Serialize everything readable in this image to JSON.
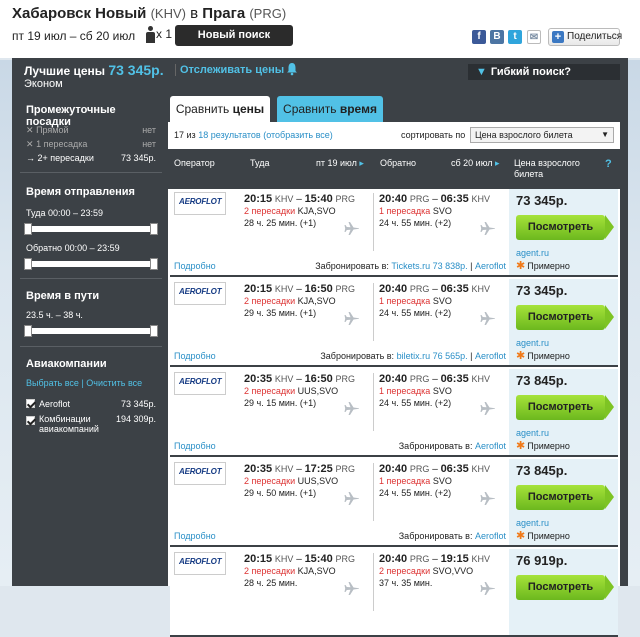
{
  "header": {
    "from_city": "Хабаровск Новый",
    "from_code": "(KHV)",
    "in_word": "в",
    "to_city": "Прага",
    "to_code": "(PRG)",
    "dates": "пт 19 июл – сб 20 июл",
    "passengers": "x 1",
    "new_search": "Новый поиск",
    "share_label": "Поделиться",
    "social_icons": [
      "facebook-icon",
      "vk-icon",
      "twitter-icon",
      "mail-icon"
    ]
  },
  "summary": {
    "best_label": "Лучшие цены",
    "best_price": "73 345р.",
    "track_label": "Отслеживать цены",
    "class": "Эконом",
    "flex_label": "Гибкий поиск?"
  },
  "sidebar": {
    "stops_title": "Промежуточные посадки",
    "stops": [
      {
        "label": "Прямой",
        "value": "нет",
        "mark": "✕"
      },
      {
        "label": "1 пересадка",
        "value": "нет",
        "mark": "✕"
      },
      {
        "label": "2+ пересадки",
        "value": "73 345р.",
        "mark": "→"
      }
    ],
    "departure_title": "Время отправления",
    "there_range": "Туда 00:00 – 23:59",
    "back_range": "Обратно 00:00 – 23:59",
    "travel_title": "Время в пути",
    "travel_range": "23.5 ч. – 38 ч.",
    "airlines_title": "Авиакомпании",
    "select_all": "Выбрать все",
    "clear_all": "Очистить все",
    "airlines": [
      {
        "name": "Aeroflot",
        "price": "73 345р."
      },
      {
        "name": "Комбинации авиакомпаний",
        "price": "194 309р."
      }
    ]
  },
  "tabs": {
    "prices_a": "Сравнить ",
    "prices_b": "цены",
    "time_a": "Сравнить ",
    "time_b": "время"
  },
  "results": {
    "shown": "17 из",
    "total": "18 результатов (отобразить все)",
    "sort_label": "сортировать по",
    "sort_value": "Цена взрослого билета"
  },
  "table_header": {
    "operator": "Оператор",
    "there": "Туда",
    "there_date": "пт 19 июл",
    "back": "Обратно",
    "back_date": "сб 20 июл",
    "price": "Цена взрослого билета",
    "help": "?"
  },
  "rows": [
    {
      "airline": "AEROFLOT",
      "out_dep": "20:15",
      "out_dep_code": "KHV",
      "out_arr": "15:40",
      "out_arr_code": "PRG",
      "out_stops": "2 пересадки",
      "out_via": "KJA,SVO",
      "out_dur": "28 ч. 25 мин. (+1)",
      "ret_dep": "20:40",
      "ret_dep_code": "PRG",
      "ret_arr": "06:35",
      "ret_arr_code": "KHV",
      "ret_stops": "1 пересадка",
      "ret_via": "SVO",
      "ret_dur": "24 ч. 55 мин. (+2)",
      "price": "73 345р.",
      "button": "Посмотреть",
      "agent": "agent.ru",
      "approx": "Примерно",
      "more": "Подробно",
      "book_label": "Забронировать в:",
      "book_links": "Tickets.ru 73 838р.",
      "book_last": "Aeroflot"
    },
    {
      "airline": "AEROFLOT",
      "out_dep": "20:15",
      "out_dep_code": "KHV",
      "out_arr": "16:50",
      "out_arr_code": "PRG",
      "out_stops": "2 пересадки",
      "out_via": "KJA,SVO",
      "out_dur": "29 ч. 35 мин. (+1)",
      "ret_dep": "20:40",
      "ret_dep_code": "PRG",
      "ret_arr": "06:35",
      "ret_arr_code": "KHV",
      "ret_stops": "1 пересадка",
      "ret_via": "SVO",
      "ret_dur": "24 ч. 55 мин. (+2)",
      "price": "73 345р.",
      "button": "Посмотреть",
      "agent": "agent.ru",
      "approx": "Примерно",
      "more": "Подробно",
      "book_label": "Забронировать в:",
      "book_links": "biletix.ru 76 565р.",
      "book_last": "Aeroflot"
    },
    {
      "airline": "AEROFLOT",
      "out_dep": "20:35",
      "out_dep_code": "KHV",
      "out_arr": "16:50",
      "out_arr_code": "PRG",
      "out_stops": "2 пересадки",
      "out_via": "UUS,SVO",
      "out_dur": "29 ч. 15 мин. (+1)",
      "ret_dep": "20:40",
      "ret_dep_code": "PRG",
      "ret_arr": "06:35",
      "ret_arr_code": "KHV",
      "ret_stops": "1 пересадка",
      "ret_via": "SVO",
      "ret_dur": "24 ч. 55 мин. (+2)",
      "price": "73 845р.",
      "button": "Посмотреть",
      "agent": "agent.ru",
      "approx": "Примерно",
      "more": "Подробно",
      "book_label": "Забронировать в:",
      "book_links": "",
      "book_last": "Aeroflot"
    },
    {
      "airline": "AEROFLOT",
      "out_dep": "20:35",
      "out_dep_code": "KHV",
      "out_arr": "17:25",
      "out_arr_code": "PRG",
      "out_stops": "2 пересадки",
      "out_via": "UUS,SVO",
      "out_dur": "29 ч. 50 мин. (+1)",
      "ret_dep": "20:40",
      "ret_dep_code": "PRG",
      "ret_arr": "06:35",
      "ret_arr_code": "KHV",
      "ret_stops": "1 пересадка",
      "ret_via": "SVO",
      "ret_dur": "24 ч. 55 мин. (+2)",
      "price": "73 845р.",
      "button": "Посмотреть",
      "agent": "agent.ru",
      "approx": "Примерно",
      "more": "Подробно",
      "book_label": "Забронировать в:",
      "book_links": "",
      "book_last": "Aeroflot"
    },
    {
      "airline": "AEROFLOT",
      "out_dep": "20:15",
      "out_dep_code": "KHV",
      "out_arr": "15:40",
      "out_arr_code": "PRG",
      "out_stops": "2 пересадки",
      "out_via": "KJA,SVO",
      "out_dur": "28 ч. 25 мин.",
      "ret_dep": "20:40",
      "ret_dep_code": "PRG",
      "ret_arr": "19:15",
      "ret_arr_code": "KHV",
      "ret_stops": "2 пересадки",
      "ret_via": "SVO,VVO",
      "ret_dur": "37 ч. 35 мин.",
      "price": "76 919р.",
      "button": "Посмотреть",
      "agent": "",
      "approx": "",
      "more": "",
      "book_label": "",
      "book_links": "",
      "book_last": ""
    }
  ],
  "colors": {
    "accent": "#51c1e6",
    "dark": "#3c4146",
    "green": "#7ec424",
    "link": "#2a8fc7",
    "red": "#d33333"
  }
}
